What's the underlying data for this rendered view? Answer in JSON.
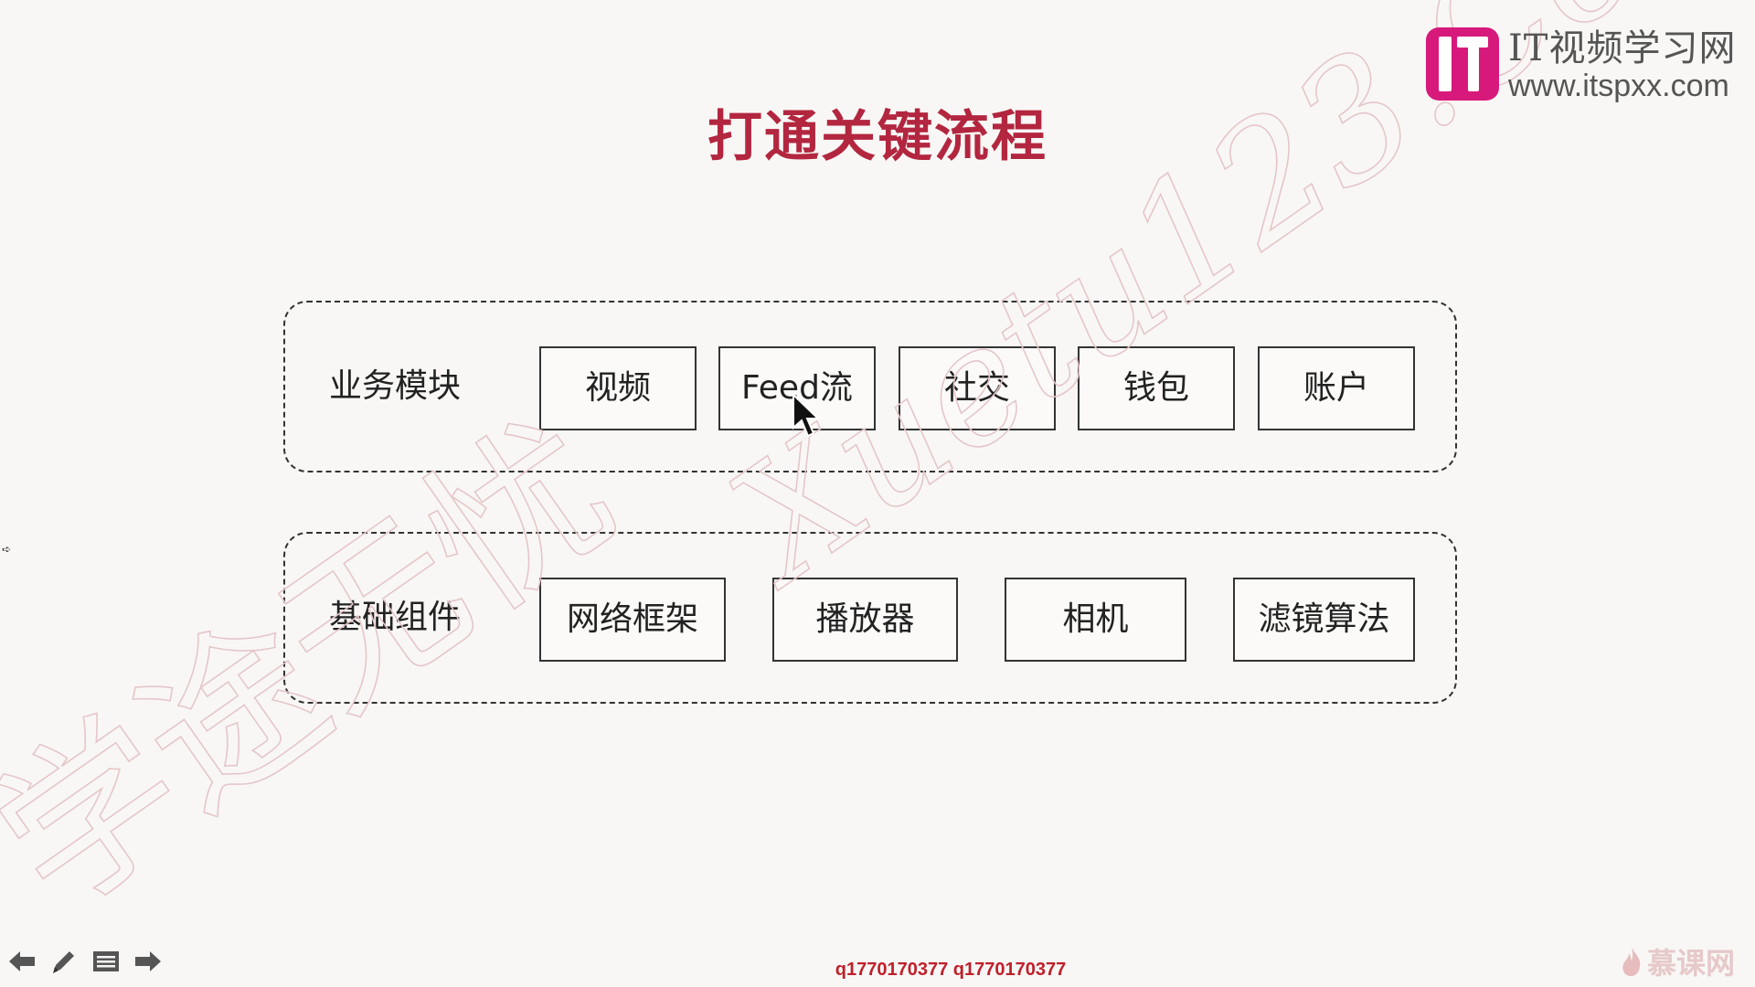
{
  "slide": {
    "title": "打通关键流程",
    "groups": [
      {
        "label": "业务模块",
        "modules": [
          "视频",
          "Feed流",
          "社交",
          "钱包",
          "账户"
        ]
      },
      {
        "label": "基础组件",
        "modules": [
          "网络框架",
          "播放器",
          "相机",
          "滤镜算法"
        ]
      }
    ]
  },
  "logo": {
    "name": "IT视频学习网",
    "url": "www.itspxx.com"
  },
  "watermark": {
    "cn": "学途无忧",
    "latin": "Xuetu123.Com"
  },
  "footer": {
    "id_text": "q1770170377 q1770170377",
    "brand": "慕课网"
  },
  "colors": {
    "title": "#b3263f",
    "logo_accent": "#d8197c",
    "footer_text": "#c01f2a",
    "watermark": "#e5c6c9"
  },
  "icons": {
    "toolbar": [
      "arrow-left-icon",
      "pen-icon",
      "menu-icon",
      "arrow-right-icon"
    ],
    "brand": "flame-icon"
  }
}
